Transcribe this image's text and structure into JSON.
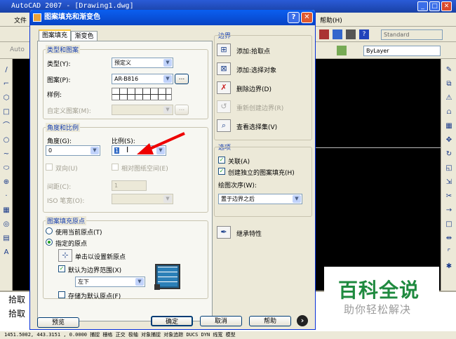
{
  "app": {
    "title": "AutoCAD 2007 - [Drawing1.dwg]",
    "menu_first": "文件",
    "menu_help": "帮助(H)",
    "style_select": "Standard",
    "layer_select": "ByLayer",
    "toolbar_left_label": "Auto",
    "command_lines": [
      "拾取",
      "拾取"
    ],
    "status_text": "1451.5002, 443.3151 , 0.0000   捕捉 栅格 正交 极轴 对象捕捉 对象追踪 DUCS DYN 线宽 模型"
  },
  "dialog": {
    "title": "图案填充和渐变色",
    "help_glyph": "?",
    "close_glyph": "✕",
    "tabs": [
      "图案填充",
      "渐变色"
    ],
    "type_group": {
      "title": "类型和图案",
      "type_label": "类型(Y):",
      "type_value": "预定义",
      "pattern_label": "图案(P):",
      "pattern_value": "AR-B816",
      "pattern_browse": "...",
      "sample_label": "样例:",
      "custom_label": "自定义图案(M):",
      "custom_browse": "..."
    },
    "angle_group": {
      "title": "角度和比例",
      "angle_label": "角度(G):",
      "angle_value": "0",
      "scale_label": "比例(S):",
      "scale_value": "1",
      "double_label": "双向(U)",
      "relative_label": "相对图纸空间(E)",
      "spacing_label": "间距(C):",
      "spacing_value": "1",
      "iso_label": "ISO 笔宽(O):"
    },
    "origin_group": {
      "title": "图案填充原点",
      "use_current": "使用当前原点(T)",
      "specified": "指定的原点",
      "click_set": "单击以设置新原点",
      "default_extents": "默认为边界范围(X)",
      "position_value": "左下",
      "store_default": "存储为默认原点(F)"
    },
    "boundary_group": {
      "title": "边界",
      "add_pick": "添加:拾取点",
      "add_select": "添加:选择对象",
      "remove": "删除边界(D)",
      "recreate": "重新创建边界(R)",
      "view_sel": "查看选择集(V)"
    },
    "options_group": {
      "title": "选项",
      "associative": "关联(A)",
      "separate": "创建独立的图案填充(H)",
      "draw_order_label": "绘图次序(W):",
      "draw_order_value": "置于边界之后"
    },
    "inherit": "继承特性",
    "buttons": {
      "preview": "预览",
      "ok": "确定",
      "cancel": "取消",
      "help": "帮助",
      "more": "›"
    }
  },
  "watermark": {
    "title": "百科全说",
    "subtitle": "助你轻松解决"
  }
}
